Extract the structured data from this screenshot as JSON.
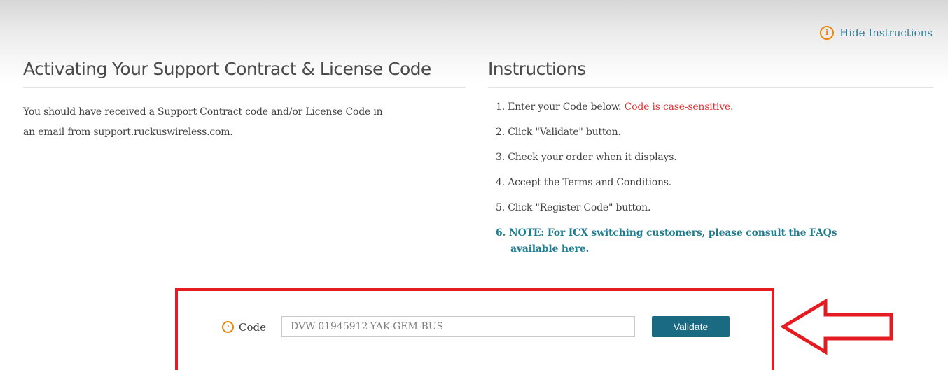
{
  "header": {
    "hide_instructions_label": "Hide Instructions",
    "hide_icon": "info-circle-icon"
  },
  "left": {
    "title": "Activating Your Support Contract & License Code",
    "intro_line1": "You should have received a Support Contract code and/or License Code in",
    "intro_line2": "an email from support.ruckuswireless.com."
  },
  "instructions": {
    "title": "Instructions",
    "step1_text": "1. Enter your Code below.",
    "step1_warning": "Code is case-sensitive.",
    "step2": "2. Click \"Validate\" button.",
    "step3": "3. Check your order when it displays.",
    "step4": "4. Accept the Terms and Conditions.",
    "step5": "5. Click \"Register Code\" button.",
    "step6_line1": "6. NOTE: For ICX  switching customers, please consult the FAQs",
    "step6_line2": "available here."
  },
  "code_form": {
    "label": "Code",
    "label_icon": "chevron-circle-right-icon",
    "value": "DVW-01945912-YAK-GEM-BUS",
    "validate_label": "Validate"
  },
  "colors": {
    "accent_teal": "#1a6b82",
    "link_teal": "#2e7f94",
    "warning_red": "#e4312f",
    "icon_orange": "#e8870c",
    "highlight_red": "#e41b21"
  }
}
